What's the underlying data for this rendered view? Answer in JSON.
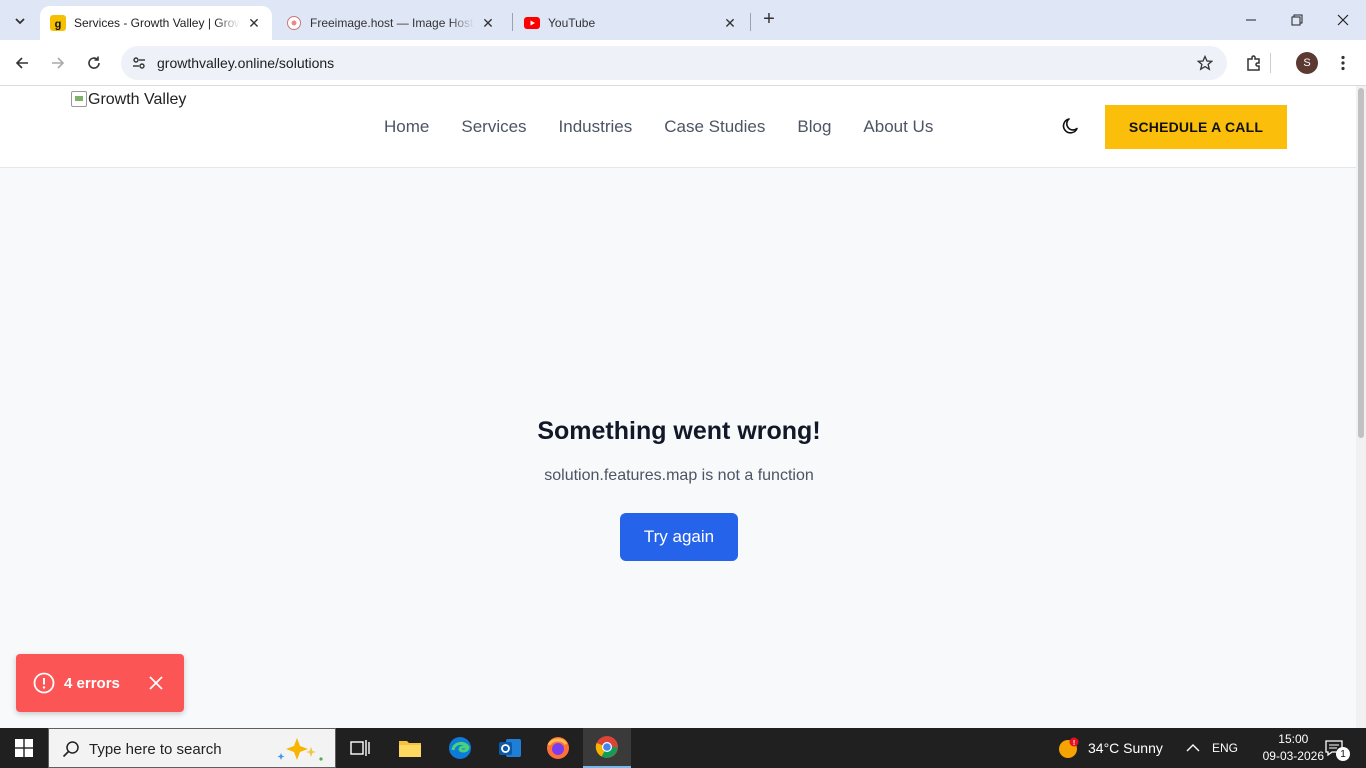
{
  "browser": {
    "tabs": [
      {
        "title": "Services - Growth Valley | Growth Valley",
        "active": true
      },
      {
        "title": "Freeimage.host — Image Hosting",
        "active": false
      },
      {
        "title": "YouTube",
        "active": false
      }
    ],
    "url": "growthvalley.online/solutions",
    "profile_initial": "S"
  },
  "site": {
    "logo_alt": "Growth Valley",
    "nav": [
      "Home",
      "Services",
      "Industries",
      "Case Studies",
      "Blog",
      "About Us"
    ],
    "cta_label": "SCHEDULE A CALL"
  },
  "error": {
    "title": "Something went wrong!",
    "message": "solution.features.map is not a function",
    "retry_label": "Try again",
    "toast_label": "4 errors"
  },
  "taskbar": {
    "search_placeholder": "Type here to search",
    "weather": "34°C  Sunny",
    "language": "ENG",
    "time": "15:00",
    "date": "09-03-2026",
    "notification_count": "1"
  },
  "colors": {
    "cta": "#fbbf0b",
    "retry": "#2563eb",
    "toast": "#fc5555"
  }
}
